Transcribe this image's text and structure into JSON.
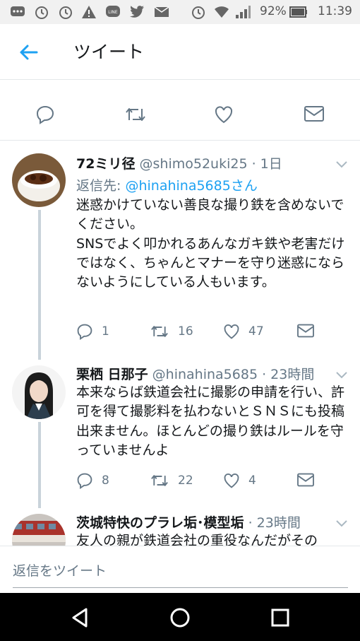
{
  "status_bar": {
    "battery": "92%",
    "time": "11:39"
  },
  "header": {
    "title": "ツイート"
  },
  "tweets": [
    {
      "name": "72ミリ径",
      "handle": "@shimo52uki25",
      "time": "· 1日",
      "reply_to_label": "返信先: ",
      "reply_to_handle": "@hinahina5685さん",
      "text": "迷惑かけていない善良な撮り鉄を含めないでください。\nSNSでよく叩かれるあんなガキ鉄や老害だけではなく、ちゃんとマナーを守り迷惑にならないようにしている人もいます。",
      "replies": "1",
      "retweets": "16",
      "likes": "47"
    },
    {
      "name": "栗栖 日那子",
      "handle": "@hinahina5685",
      "time": "· 23時間",
      "text": "本来ならば鉄道会社に撮影の申請を行い、許可を得て撮影料を払わないとＳＮＳにも投稿出来ません。ほとんどの撮り鉄はルールを守っていませんよ",
      "replies": "8",
      "retweets": "22",
      "likes": "4"
    },
    {
      "name": "茨城特快のプラレ垢･模型垢",
      "time": "· 23時間",
      "text": "友人の親が鉄道会社の重役なんだがその"
    }
  ],
  "reply_bar": {
    "placeholder": "返信をツイート"
  },
  "colors": {
    "accent": "#1da1f2",
    "muted": "#657786",
    "text": "#14171a"
  }
}
